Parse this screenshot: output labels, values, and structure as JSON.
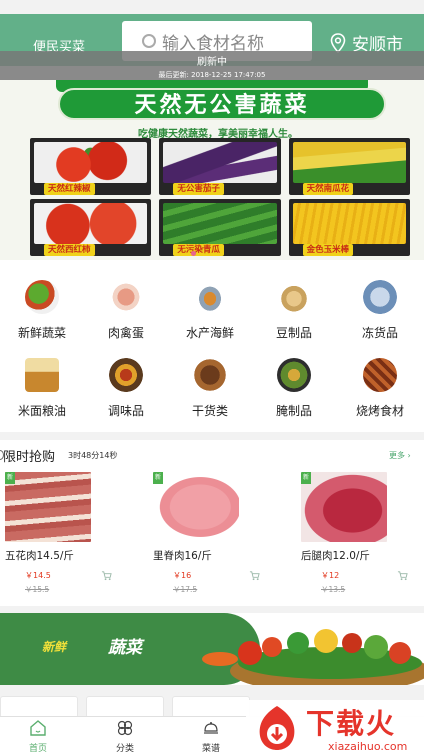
{
  "header": {
    "title": "便民买菜",
    "search_placeholder": "输入食材名称",
    "location": "安顺市",
    "bg_color": "#62b089"
  },
  "refresh": {
    "title": "刷新中",
    "last_updated": "最后更新: 2018-12-25 17:47:05"
  },
  "banner": {
    "headline": "天然无公害蔬菜",
    "subline": "吃健康天然蔬菜，享美丽幸福人生。",
    "items": [
      "天然红辣椒",
      "无公害茄子",
      "天然南瓜花",
      "天然西红柿",
      "无污染青瓜",
      "金色玉米棒"
    ]
  },
  "categories": [
    {
      "label": "新鲜蔬菜",
      "icon": "vegetables-icon"
    },
    {
      "label": "肉禽蛋",
      "icon": "meat-icon"
    },
    {
      "label": "水产海鲜",
      "icon": "seafood-icon"
    },
    {
      "label": "豆制品",
      "icon": "tofu-icon"
    },
    {
      "label": "冻货品",
      "icon": "frozen-icon"
    },
    {
      "label": "米面粮油",
      "icon": "grain-oil-icon"
    },
    {
      "label": "调味品",
      "icon": "seasoning-icon"
    },
    {
      "label": "干货类",
      "icon": "dried-goods-icon"
    },
    {
      "label": "腌制品",
      "icon": "pickled-icon"
    },
    {
      "label": "烧烤食材",
      "icon": "bbq-icon"
    }
  ],
  "flash_sale": {
    "title": "限时抢购",
    "timer": "3时48分14秒",
    "more": "更多",
    "tag": "新",
    "products": [
      {
        "name": "五花肉14.5/斤",
        "price": "￥14.5",
        "old_price": "￥15.5"
      },
      {
        "name": "里脊肉16/斤",
        "price": "￥16",
        "old_price": "￥17.5"
      },
      {
        "name": "后腿肉12.0/斤",
        "price": "￥12",
        "old_price": "￥13.5"
      }
    ]
  },
  "promo": {
    "text_1": "新鲜",
    "text_2": "蔬菜"
  },
  "bottom_nav": [
    {
      "label": "首页",
      "icon": "home-icon",
      "active": true
    },
    {
      "label": "分类",
      "icon": "category-icon",
      "active": false
    },
    {
      "label": "菜谱",
      "icon": "recipe-icon",
      "active": false
    }
  ],
  "watermark": {
    "text": "下载火",
    "url": "xiazaihuo.com"
  },
  "colors": {
    "accent": "#62b089",
    "price": "#e2381f",
    "banner_green": "#1f9a37"
  }
}
